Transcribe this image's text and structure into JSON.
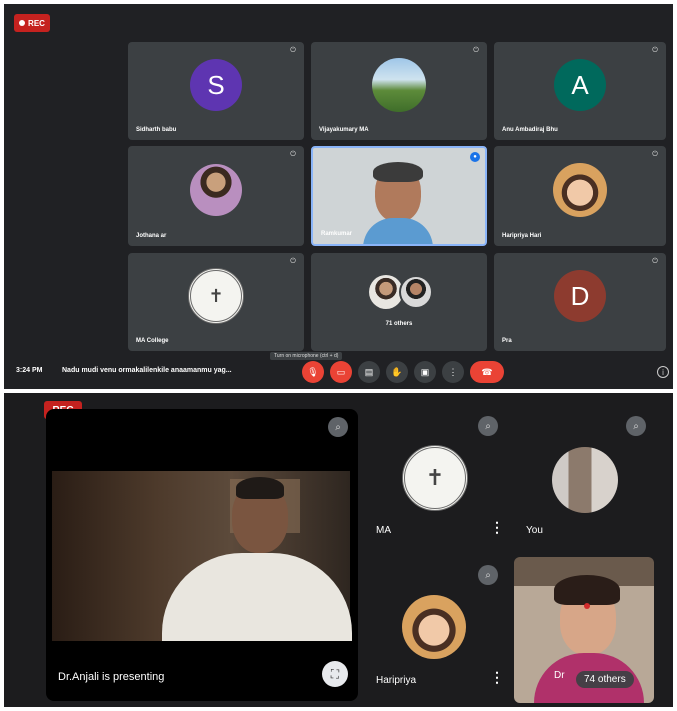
{
  "screen1": {
    "rec_label": "REC",
    "tiles": [
      {
        "name": "Sidharth babu",
        "avatar_type": "letter",
        "letter": "S",
        "color": "#5e35b1"
      },
      {
        "name": "Vijayakumary MA",
        "avatar_type": "photo-landscape"
      },
      {
        "name": "Anu Ambadiraj Bhu",
        "avatar_type": "letter",
        "letter": "A",
        "color": "#00695c"
      },
      {
        "name": "Jothana ar",
        "avatar_type": "photo-person"
      },
      {
        "name": "Ramkumar",
        "avatar_type": "video-speaker"
      },
      {
        "name": "Haripriya Hari",
        "avatar_type": "photo-child"
      },
      {
        "name": "MA College",
        "avatar_type": "photo-emblem"
      },
      {
        "name": "71 others",
        "avatar_type": "group"
      },
      {
        "name": "Pra",
        "avatar_type": "letter",
        "letter": "D",
        "color": "#8d3b2f"
      }
    ],
    "bottom_bar": {
      "time": "3:24 PM",
      "meeting_title": "Nadu mudi venu ormakalilenkile anaamanmu yag...",
      "tooltip": "Turn on microphone (ctrl + d)"
    }
  },
  "screen2": {
    "rec_label": "REC",
    "presenter_label": "Dr.Anjali is presenting",
    "tiles": [
      {
        "name": "MA",
        "avatar_type": "photo-emblem"
      },
      {
        "name": "You",
        "avatar_type": "photo-partial"
      },
      {
        "name": "Haripriya",
        "avatar_type": "photo-child"
      }
    ],
    "others_chip": "74 others",
    "partial_name": "Dr"
  },
  "colors": {
    "background_dark": "#202124",
    "tile_gray": "#3c4043",
    "record_red": "#c5221f",
    "end_call_red": "#ea4335"
  }
}
